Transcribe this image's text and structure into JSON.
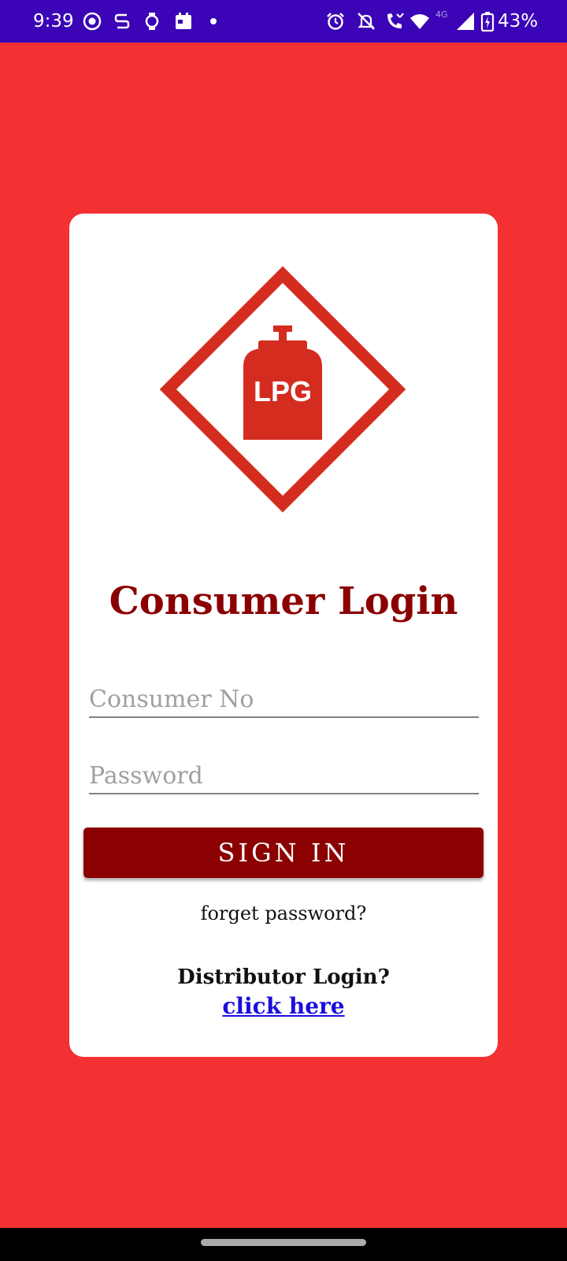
{
  "status_bar": {
    "time": "9:39",
    "network": "4G",
    "battery": "43%",
    "left_icons": [
      "record-icon",
      "sync-icon",
      "watch-icon",
      "calendar-icon",
      "notification-dot-icon"
    ],
    "right_icons": [
      "alarm-icon",
      "mute-icon",
      "wifi-calling-icon",
      "wifi-icon",
      "signal-icon",
      "battery-icon"
    ]
  },
  "logo": {
    "text": "LPG",
    "colors": {
      "primary": "#d42c1f",
      "background": "#ffffff"
    }
  },
  "login": {
    "title": "Consumer Login",
    "consumer_placeholder": "Consumer No",
    "consumer_value": "",
    "password_placeholder": "Password",
    "password_value": "",
    "sign_in_label": "SIGN IN",
    "forget_password": "forget password?",
    "distributor_prompt": "Distributor Login?",
    "distributor_link": "click here"
  },
  "colors": {
    "background": "#f33133",
    "status_bar": "#3b04b7",
    "title": "#8b0000",
    "button": "#8b0000",
    "link": "#1a0ddb"
  }
}
